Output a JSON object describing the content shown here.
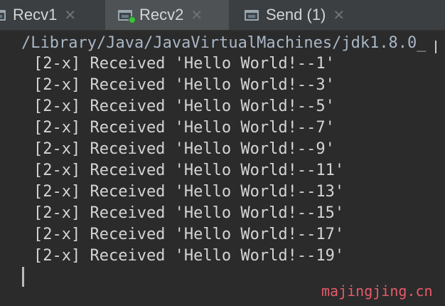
{
  "tabs": [
    {
      "label": "Recv1",
      "active": false
    },
    {
      "label": "Recv2",
      "active": true
    },
    {
      "label": "Send (1)",
      "active": false
    }
  ],
  "close_glyph": "✕",
  "console": {
    "command": "/Library/Java/JavaVirtualMachines/jdk1.8.0_",
    "lines": [
      "[2-x] Received 'Hello World!--1'",
      "[2-x] Received 'Hello World!--3'",
      "[2-x] Received 'Hello World!--5'",
      "[2-x] Received 'Hello World!--7'",
      "[2-x] Received 'Hello World!--9'",
      "[2-x] Received 'Hello World!--11'",
      "[2-x] Received 'Hello World!--13'",
      "[2-x] Received 'Hello World!--15'",
      "[2-x] Received 'Hello World!--17'",
      "[2-x] Received 'Hello World!--19'"
    ]
  },
  "watermark": "majingjing.cn",
  "colors": {
    "background": "#2b2b2b",
    "tabbar": "#3c3f41",
    "active_tab": "#4e5254",
    "text": "#d4d4d4",
    "watermark": "#e85a6a",
    "status_dot": "#3fbf3f"
  }
}
